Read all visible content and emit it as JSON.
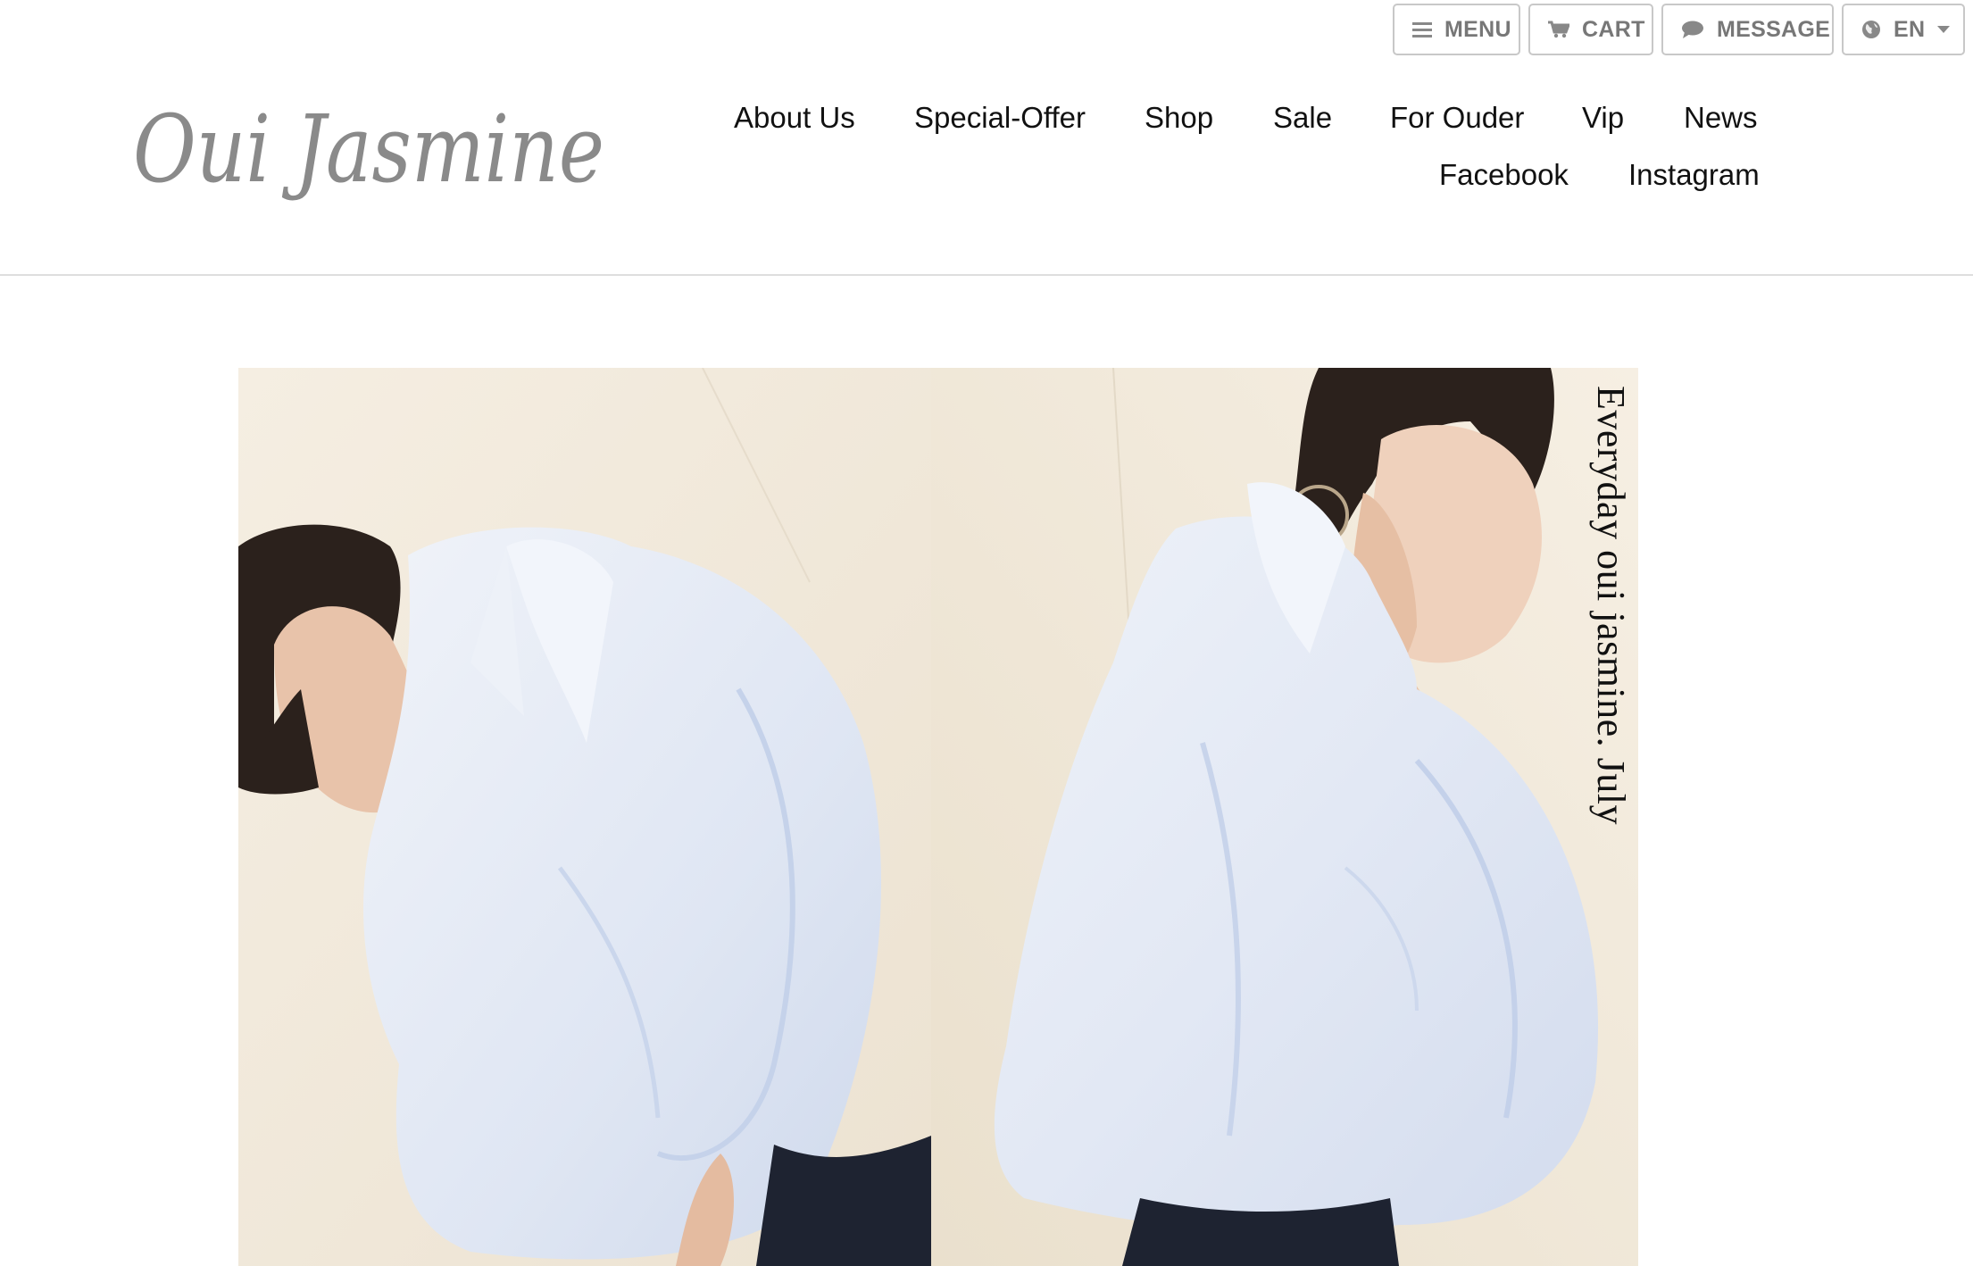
{
  "brand": {
    "logo_text": "Oui Jasmine",
    "logo_color": "#8a8a8a"
  },
  "utility_buttons": {
    "menu": {
      "label": "MENU",
      "icon": "hamburger-icon"
    },
    "cart": {
      "label": "CART",
      "icon": "cart-icon"
    },
    "message": {
      "label": "MESSAGE",
      "icon": "chat-bubble-icon"
    },
    "language": {
      "label": "EN",
      "icon": "globe-icon",
      "dropdown_icon": "caret-down-icon"
    }
  },
  "nav": {
    "row1": [
      "About Us",
      "Special-Offer",
      "Shop",
      "Sale",
      "For Ouder",
      "Vip",
      "News"
    ],
    "row2": [
      "Facebook",
      "Instagram"
    ]
  },
  "hero": {
    "caption": "Everyday oui jasmine. July",
    "background_color": "#f4ede1",
    "shirt_color": "#e3e9f4"
  }
}
